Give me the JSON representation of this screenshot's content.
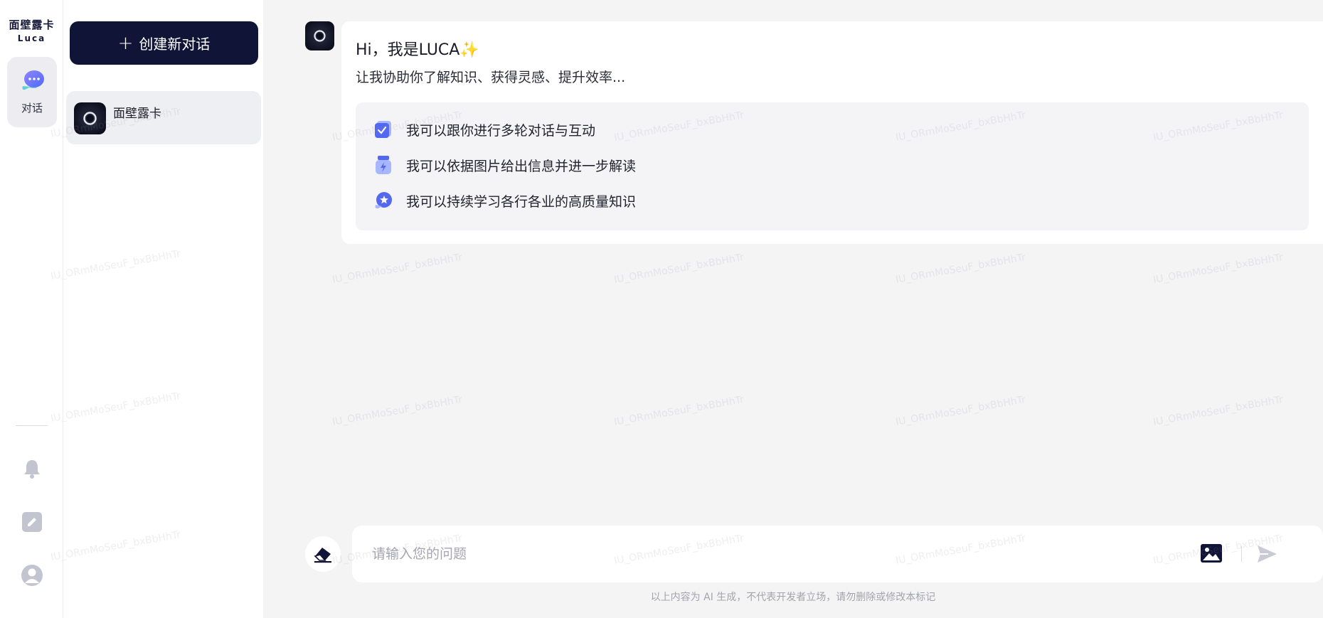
{
  "brand": {
    "name_cn": "面壁露卡",
    "name_en": "Luca"
  },
  "rail": {
    "items": [
      {
        "label": "对话",
        "icon": "chat-bubble-icon",
        "active": true
      },
      {
        "icon": "bell-icon"
      },
      {
        "icon": "edit-icon"
      },
      {
        "icon": "user-avatar-icon"
      }
    ]
  },
  "sidebar": {
    "new_chat_label": "创建新对话",
    "conversations": [
      {
        "name": "面壁露卡",
        "icon": "luca-avatar-icon",
        "active": true
      }
    ]
  },
  "welcome": {
    "greeting": "Hi，我是LUCA",
    "greeting_emoji": "✨",
    "subtitle": "让我协助你了解知识、获得灵感、提升效率...",
    "features": [
      {
        "icon": "dialogue-check-icon",
        "text": "我可以跟你进行多轮对话与互动"
      },
      {
        "icon": "image-analysis-icon",
        "text": "我可以依据图片给出信息并进一步解读"
      },
      {
        "icon": "knowledge-star-icon",
        "text": "我可以持续学习各行各业的高质量知识"
      }
    ]
  },
  "composer": {
    "placeholder": "请输入您的问题",
    "disclaimer": "以上内容为 AI 生成，不代表开发者立场，请勿删除或修改本标记"
  },
  "watermark_text": "IU_ORmMoSeuF_bxBbHhTr",
  "colors": {
    "primary_dark": "#101437",
    "accent_blue": "#4f6bf5",
    "accent_purple": "#8b7cf8",
    "background": "#f4f4f5"
  }
}
